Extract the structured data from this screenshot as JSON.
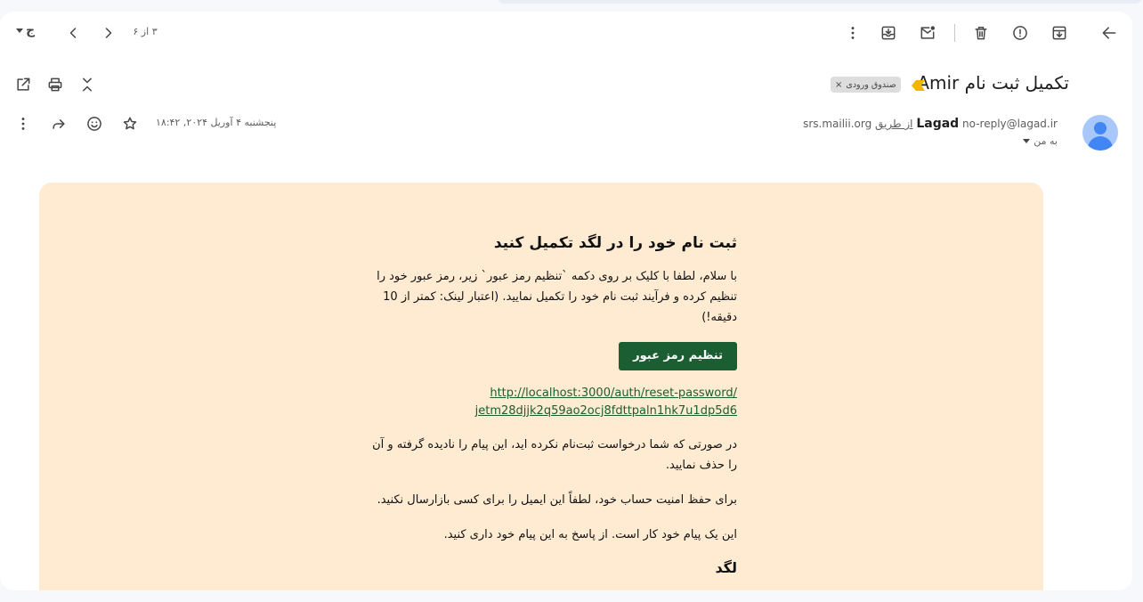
{
  "toolbar": {
    "pager_text": "۳ از ۶",
    "input_tool_label": "ج"
  },
  "message": {
    "subject": "تکمیل ثبت نام Amir",
    "label": "صندوق ورودی",
    "label_remove": "×",
    "sender_name": "Lagad",
    "sender_email": "no-reply@lagad.ir",
    "via_text": "از طریق",
    "via_domain": "srs.mailii.org",
    "to_text": "به من",
    "date": "پنجشنبه ۴ آوریل ۲۰۲۴, ۱۸:۴۲"
  },
  "email": {
    "heading": "ثبت نام خود را در لگد تکمیل کنید",
    "intro": "با سلام، لطفا با کلیک بر روی دکمه `تنظیم رمز عبور` زیر، رمز عبور خود را تنظیم کرده و فرآیند ثبت نام خود را تکمیل نمایید. (اعتبار لینک: کمتر از 10 دقیقه!)",
    "button_label": "تنظیم رمز عبور",
    "link_line1": "http://localhost:3000/auth/reset-password/",
    "link_line2": "jetm28djjk2q59ao2ocj8fdttpaln1hk7u1dp5d6",
    "ignore_text": "در صورتی که شما درخواست ثبت‌نام نکرده اید، این پیام را نادیده گرفته و آن را حذف نمایید.",
    "security_text": "برای حفظ امنیت حساب خود، لطفاً این ایمیل را برای کسی بازارسال نکنید.",
    "auto_text": "این یک پیام خود کار است. از پاسخ به این پیام خود داری کنید.",
    "signature": "لگد"
  },
  "colors": {
    "card_bg": "#ffebd2",
    "button_bg": "#1a5e32",
    "link": "#1a5e32",
    "important_marker": "#f2b600"
  }
}
